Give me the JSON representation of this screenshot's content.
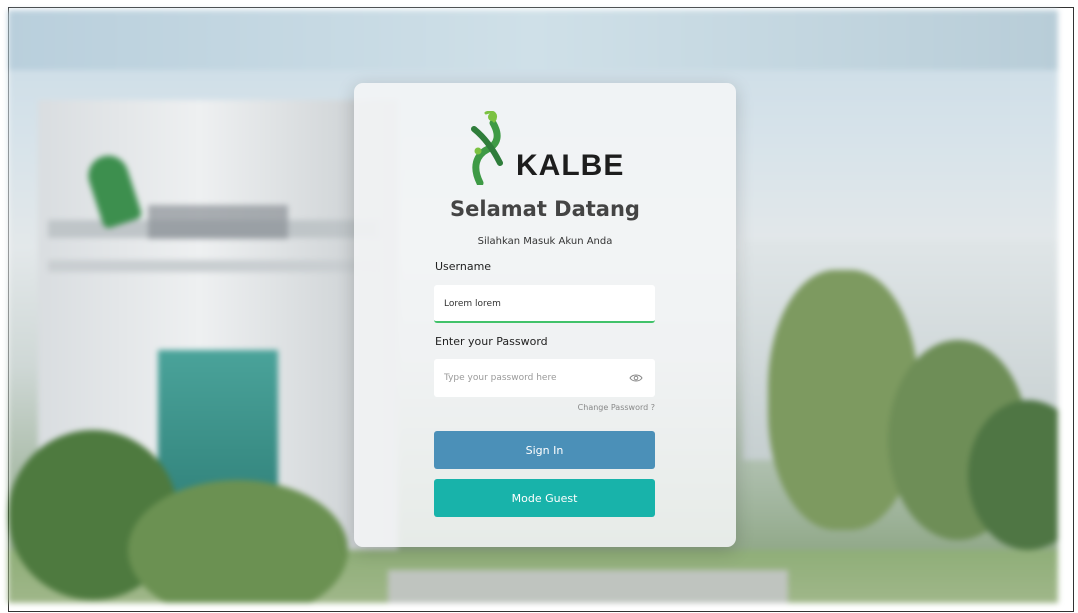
{
  "brand": {
    "name": "KALBE",
    "color_green": "#3e9a45",
    "color_dark": "#1d1d1d"
  },
  "login": {
    "title": "Selamat Datang",
    "subtitle": "Silahkan Masuk Akun Anda",
    "username_label": "Username",
    "username_value": "Lorem lorem",
    "password_label": "Enter your Password",
    "password_placeholder": "Type your password here",
    "change_password": "Change Password ?",
    "sign_in": "Sign In",
    "guest": "Mode Guest"
  },
  "colors": {
    "sign_in_button": "#4b90b8",
    "guest_button": "#18b3aa",
    "input_focus_underline": "#41c26a"
  },
  "icons": {
    "password_toggle": "eye-icon"
  }
}
